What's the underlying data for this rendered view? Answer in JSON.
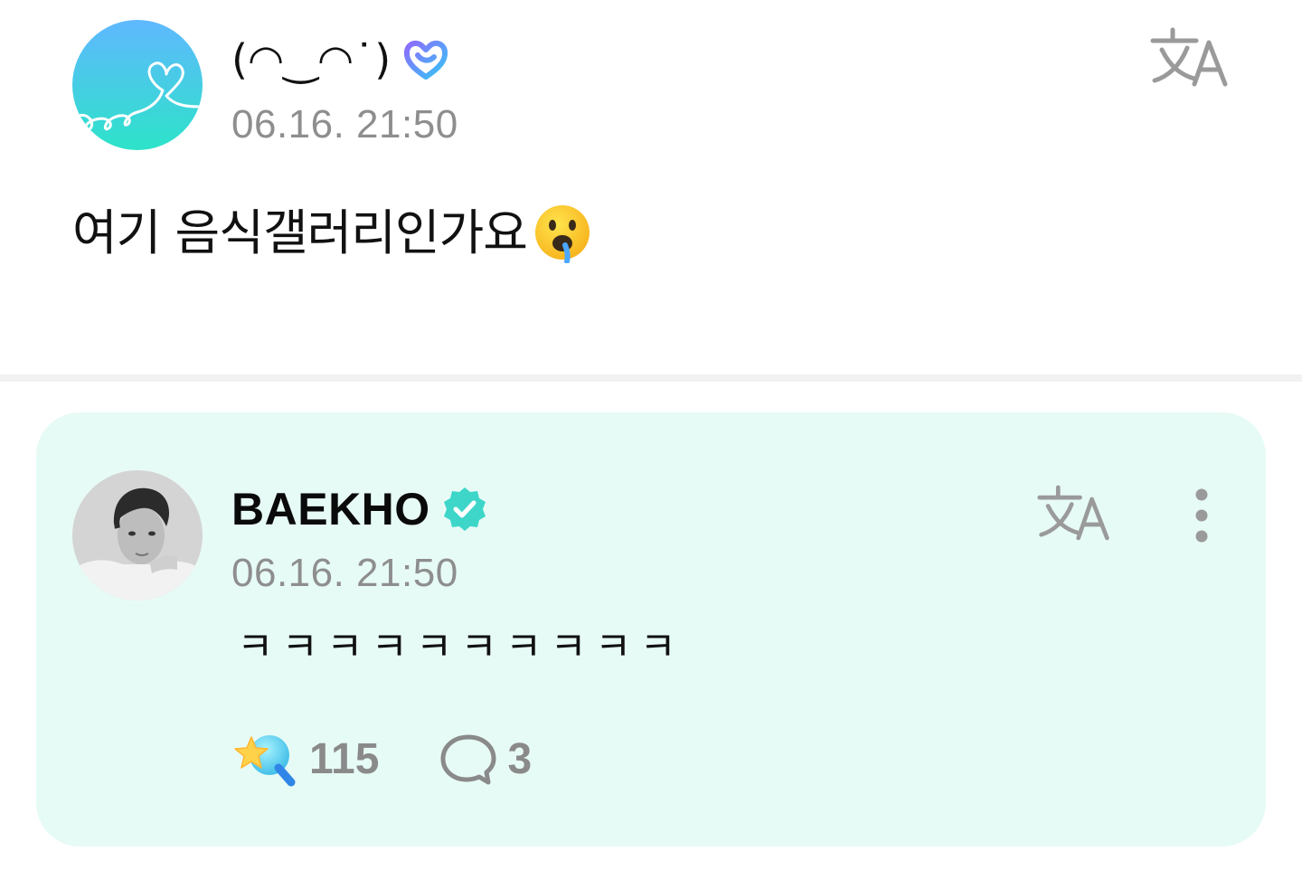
{
  "post": {
    "author_name": "(◠‿◠˙)",
    "timestamp": "06.16. 21:50",
    "text": "여기 음식갤러리인가요",
    "emoji": "drooling-face",
    "avatar": "heart-line-logo-avatar",
    "badge": "fan-membership-badge-icon"
  },
  "comment": {
    "author_name": "BAEKHO",
    "timestamp": "06.16. 21:50",
    "text": "ㅋㅋㅋㅋㅋㅋㅋㅋㅋㅋ",
    "badge": "verified-artist-badge-icon",
    "like_count": "115",
    "reply_count": "3"
  },
  "colors": {
    "card_background": "#e7fbf6",
    "verified": "#3dd6c9",
    "timestamp": "#8e8e8e",
    "avatar_gradient_top": "#5fb8ff",
    "avatar_gradient_bottom": "#2de3c9"
  }
}
